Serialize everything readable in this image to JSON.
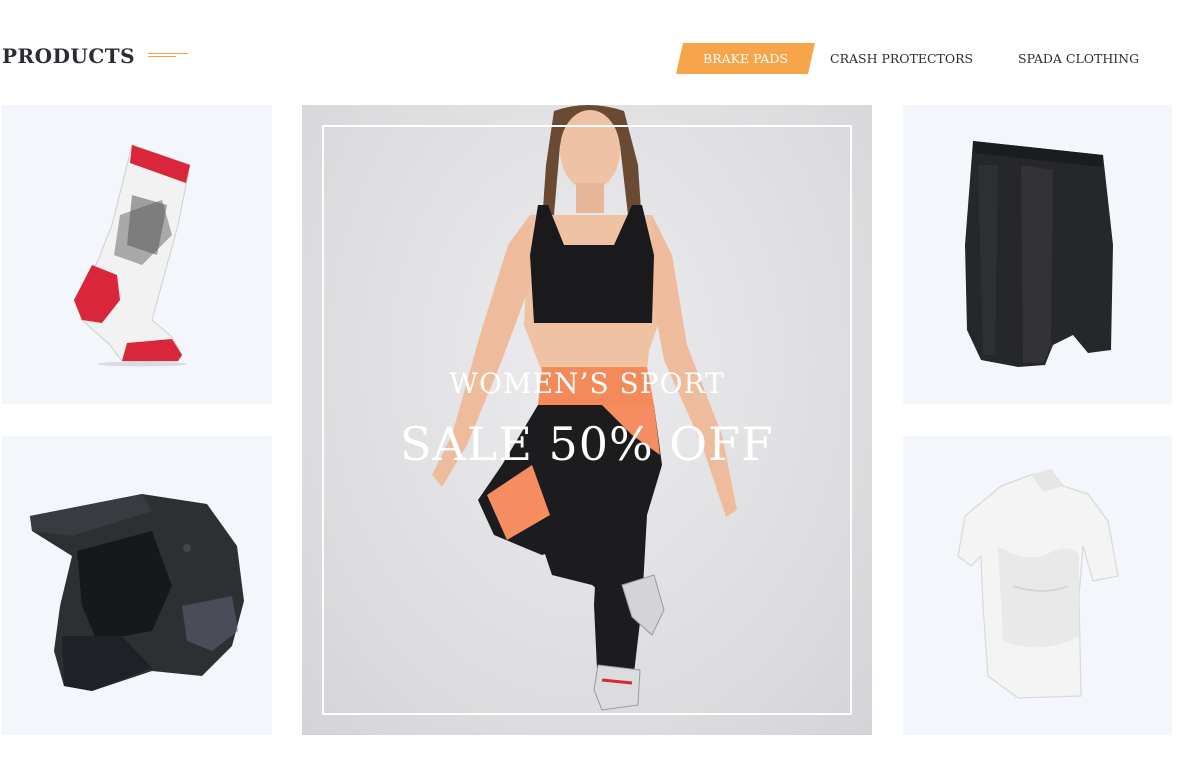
{
  "section": {
    "title": "PRODUCTS"
  },
  "tabs": [
    {
      "label": "BRAKE PADS",
      "active": true
    },
    {
      "label": "CRASH PROTECTORS",
      "active": false
    },
    {
      "label": "SPADA CLOTHING",
      "active": false
    }
  ],
  "banner": {
    "subtitle": "WOMEN’S SPORT",
    "title": "SALE 50% OFF"
  },
  "products": [
    {
      "image": "motocross-sock"
    },
    {
      "image": "motocross-helmet"
    },
    {
      "image": "compression-shorts"
    },
    {
      "image": "compression-shirt"
    }
  ],
  "colors": {
    "accent": "#f7a54a",
    "heading": "#2b2b33",
    "tile_background": "#f3f6fa"
  }
}
